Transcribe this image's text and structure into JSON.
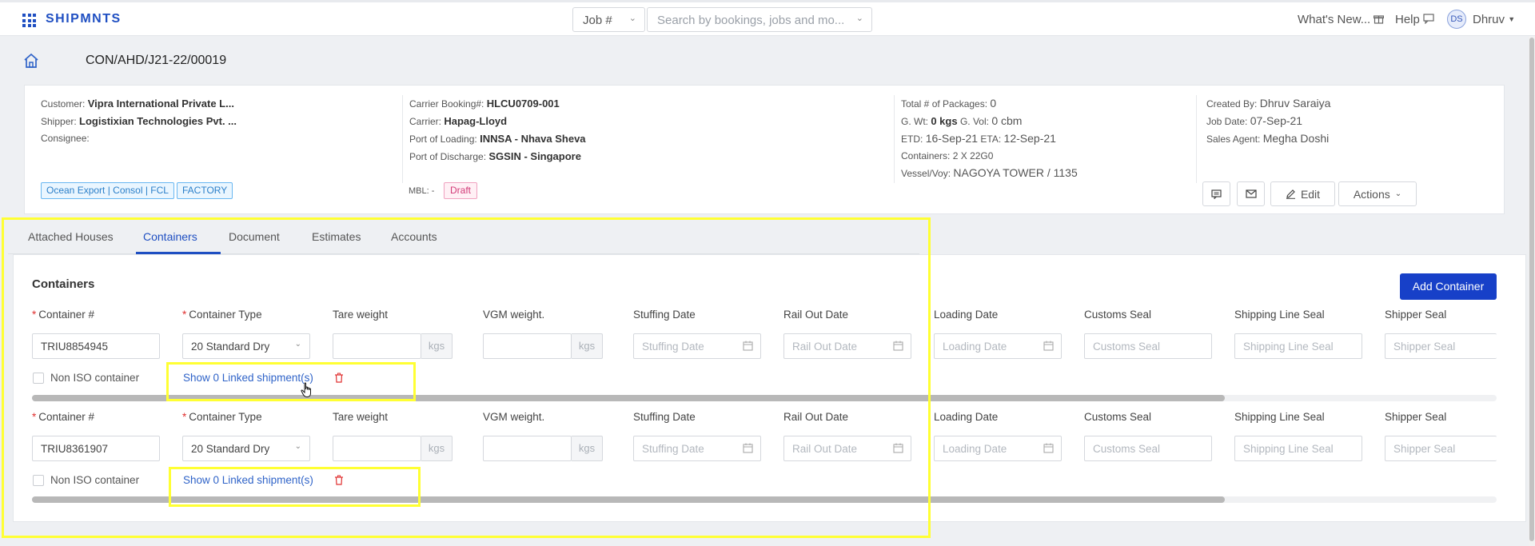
{
  "topnav": {
    "brand": "SHIPMNTS",
    "job_select": "Job #",
    "search_placeholder": "Search by bookings, jobs and mo...",
    "whats_new": "What's New...",
    "help": "Help",
    "avatar_initials": "DS",
    "user": "Dhruv"
  },
  "job": {
    "id": "CON/AHD/J21-22/00019"
  },
  "summary": {
    "customer_label": "Customer:",
    "customer": "Vipra International Private L...",
    "shipper_label": "Shipper:",
    "shipper": "Logistixian Technologies Pvt. ...",
    "consignee_label": "Consignee:",
    "carrier_booking_label": "Carrier Booking#:",
    "carrier_booking": "HLCU0709-001",
    "carrier_label": "Carrier:",
    "carrier": "Hapag-Lloyd",
    "pol_label": "Port of Loading:",
    "pol": "INNSA - Nhava Sheva",
    "pod_label": "Port of Discharge:",
    "pod": "SGSIN - Singapore",
    "packages_label": "Total # of Packages:",
    "packages": "0",
    "gwt_label": "G. Wt:",
    "gwt": "0 kgs",
    "gvol_label": "G. Vol:",
    "gvol": "0 cbm",
    "etd_label": "ETD:",
    "etd": "16-Sep-21",
    "eta_label": "ETA:",
    "eta": "12-Sep-21",
    "containers_label": "Containers:",
    "containers": "2 X 22G0",
    "vessel_label": "Vessel/Voy:",
    "vessel": "NAGOYA TOWER / 1135",
    "created_by_label": "Created By:",
    "created_by": "Dhruv Saraiya",
    "job_date_label": "Job Date:",
    "job_date": "07-Sep-21",
    "sales_agent_label": "Sales Agent:",
    "sales_agent": "Megha Doshi",
    "tags": [
      "Ocean Export | Consol | FCL",
      "FACTORY"
    ],
    "mbl_label": "MBL: -",
    "status": "Draft",
    "edit_label": "Edit",
    "actions_label": "Actions"
  },
  "tabs": [
    "Attached Houses",
    "Containers",
    "Document",
    "Estimates",
    "Accounts"
  ],
  "containers_section": {
    "title": "Containers",
    "add_button": "Add Container",
    "labels": {
      "container_no": "Container #",
      "container_type": "Container Type",
      "tare_weight": "Tare weight",
      "vgm_weight": "VGM weight.",
      "stuffing_date": "Stuffing Date",
      "rail_out_date": "Rail Out Date",
      "loading_date": "Loading Date",
      "customs_seal": "Customs Seal",
      "shipping_line_seal": "Shipping Line Seal",
      "shipper_seal": "Shipper Seal"
    },
    "placeholders": {
      "stuffing_date": "Stuffing Date",
      "rail_out_date": "Rail Out Date",
      "loading_date": "Loading Date",
      "customs_seal": "Customs Seal",
      "shipping_line_seal": "Shipping Line Seal",
      "shipper_seal": "Shipper Seal"
    },
    "unit_kgs": "kgs",
    "non_iso_label": "Non ISO container",
    "rows": [
      {
        "container_no": "TRIU8854945",
        "container_type": "20 Standard Dry",
        "linked": "Show 0 Linked shipment(s)"
      },
      {
        "container_no": "TRIU8361907",
        "container_type": "20 Standard Dry",
        "linked": "Show 0 Linked shipment(s)"
      }
    ]
  },
  "colors": {
    "accent": "#1f4fc2",
    "button": "#1740c8",
    "highlight": "#ffff33"
  }
}
